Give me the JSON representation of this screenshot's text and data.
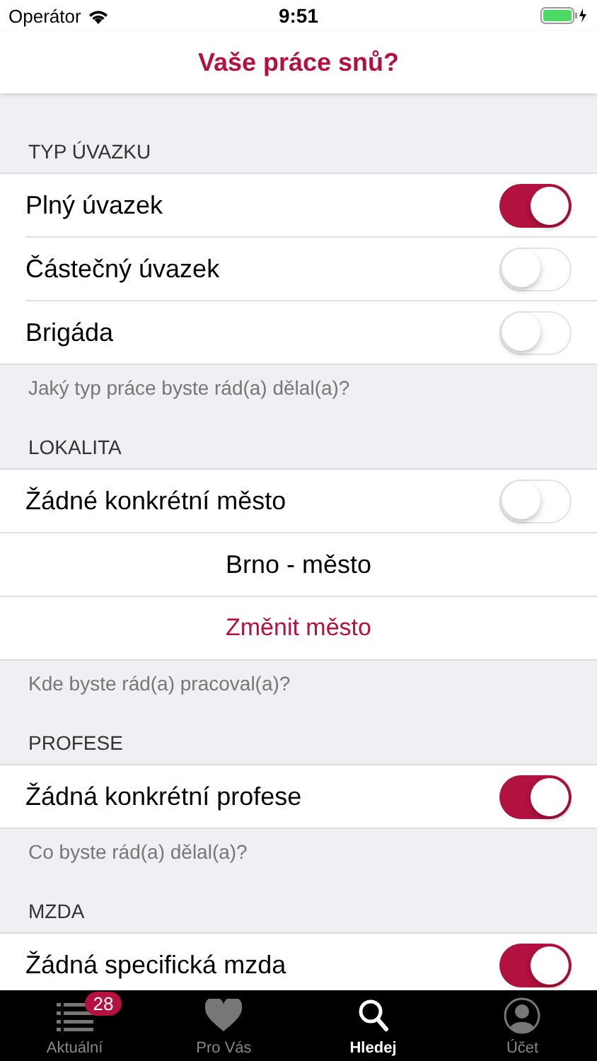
{
  "status_bar": {
    "carrier": "Operátor",
    "time": "9:51"
  },
  "nav_bar": {
    "title": "Vaše práce snů?"
  },
  "sections": [
    {
      "header": "TYP ÚVAZKU",
      "footer": "Jaký typ práce byste rád(a) dělal(a)?",
      "rows": [
        {
          "kind": "toggle",
          "label": "Plný úvazek",
          "on": true
        },
        {
          "kind": "toggle",
          "label": "Částečný úvazek",
          "on": false
        },
        {
          "kind": "toggle",
          "label": "Brigáda",
          "on": false
        }
      ]
    },
    {
      "header": "LOKALITA",
      "footer": "Kde byste rád(a) pracoval(a)?",
      "rows": [
        {
          "kind": "toggle",
          "label": "Žádné konkrétní město",
          "on": false
        },
        {
          "kind": "value",
          "label": "Brno - město"
        },
        {
          "kind": "action",
          "label": "Změnit město"
        }
      ]
    },
    {
      "header": "PROFESE",
      "footer": "Co byste rád(a) dělal(a)?",
      "rows": [
        {
          "kind": "toggle",
          "label": "Žádná konkrétní profese",
          "on": true
        }
      ]
    },
    {
      "header": "MZDA",
      "rows": [
        {
          "kind": "toggle",
          "label": "Žádná specifická mzda",
          "on": true
        }
      ]
    }
  ],
  "tab_bar": [
    {
      "kind": "list",
      "label": "Aktuální",
      "badge": "28",
      "selected": false
    },
    {
      "kind": "heart",
      "label": "Pro Vás",
      "selected": false
    },
    {
      "kind": "search",
      "label": "Hledej",
      "selected": true
    },
    {
      "kind": "account",
      "label": "Účet",
      "selected": false
    }
  ]
}
